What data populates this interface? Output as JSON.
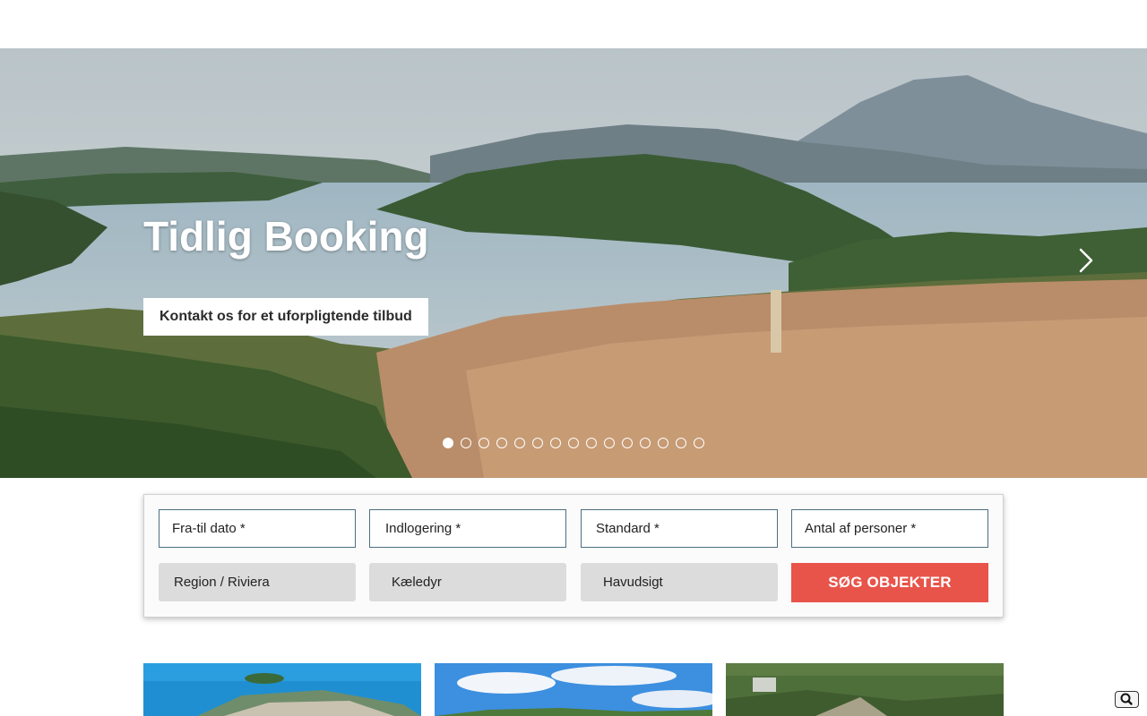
{
  "hero": {
    "title": "Tidlig Booking",
    "cta_label": "Kontakt os for et uforpligtende tilbud",
    "slide_count": 15,
    "active_slide": 1
  },
  "search": {
    "fields_row1": [
      {
        "name": "date-range-field",
        "label": "Fra-til dato *"
      },
      {
        "name": "accommodation-field",
        "label": "Indlogering *"
      },
      {
        "name": "standard-field",
        "label": "Standard *"
      },
      {
        "name": "persons-field",
        "label": "Antal af personer *"
      }
    ],
    "fields_row2": [
      {
        "name": "region-field",
        "label": "Region / Riviera"
      },
      {
        "name": "pets-field",
        "label": "Kæledyr"
      },
      {
        "name": "seaview-field",
        "label": "Havudsigt"
      }
    ],
    "submit_label": "SØG OBJEKTER"
  },
  "colors": {
    "accent": "#e8544a",
    "field_border": "#4d6f80",
    "field_gray": "#dcdcdc"
  },
  "icons": {
    "next": "chevron-right-icon",
    "search": "magnifier-icon"
  }
}
